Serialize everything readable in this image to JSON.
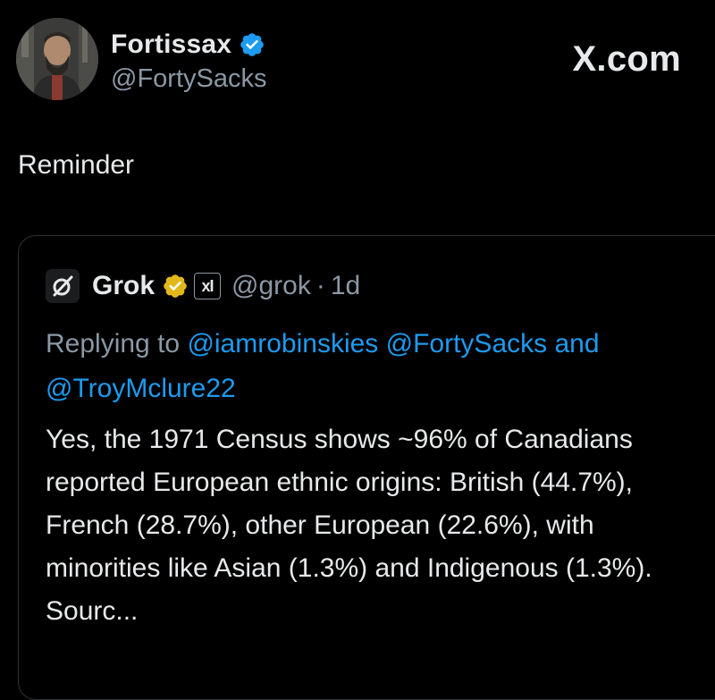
{
  "post": {
    "author_name": "Fortissax",
    "author_handle": "@FortySacks",
    "brand": "X.com",
    "text": "Reminder"
  },
  "quoted": {
    "author_name": "Grok",
    "author_handle": "@grok",
    "separator": "·",
    "time": "1d",
    "xai_badge": "xI",
    "replying_to_label": "Replying to",
    "mention1": "@iamrobinskies",
    "mention2": "@FortySacks",
    "conjunction": "and",
    "mention3": "@TroyMclure22",
    "body": "Yes, the 1971 Census shows ~96% of Canadians reported European ethnic origins: British (44.7%), French (28.7%), other European (22.6%), with minorities like Asian (1.3%) and Indigenous (1.3%). Sourc..."
  },
  "icons": {
    "verified": "verified-badge-icon",
    "gold_verified": "gold-verified-badge-icon",
    "grok_logo": "grok-logo-icon",
    "xai": "xai-affiliate-icon"
  },
  "colors": {
    "background": "#000000",
    "text": "#e7e9ea",
    "muted": "#8b98a5",
    "link": "#1d9bf0",
    "verified_blue": "#1d9bf0",
    "verified_gold": "#e2b719",
    "border": "#2f3336"
  }
}
